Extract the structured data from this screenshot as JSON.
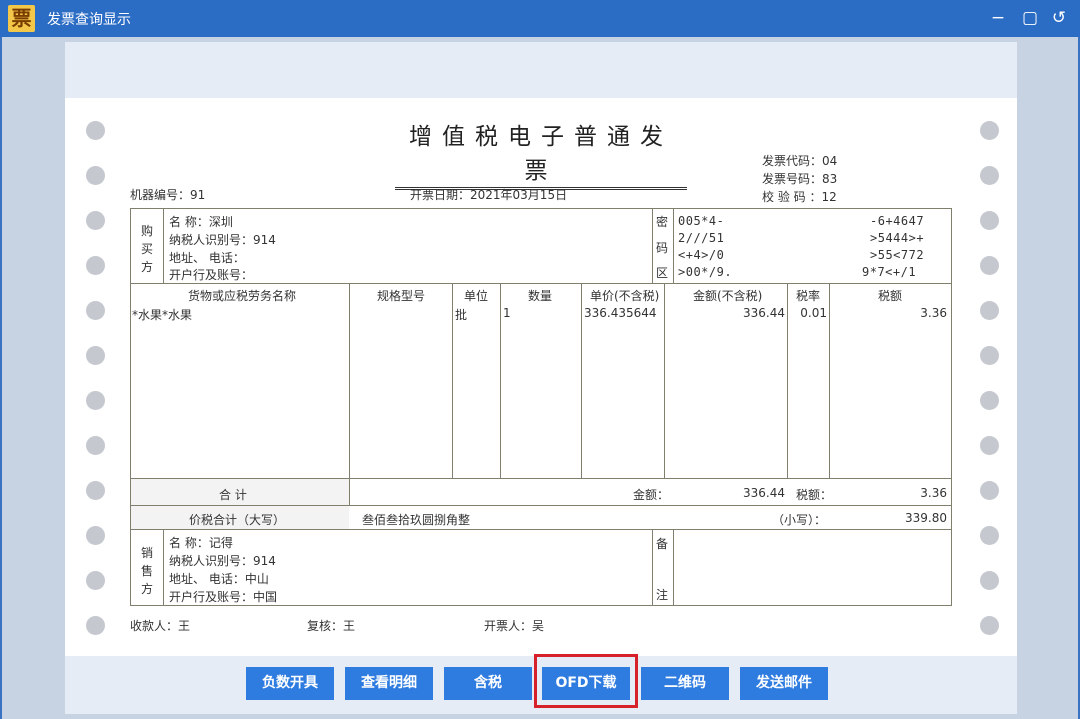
{
  "window": {
    "app_icon": "票",
    "title": "发票查询显示",
    "minimize": "−",
    "restore": "▢",
    "back": "↺"
  },
  "invoice": {
    "title": "增值税电子普通发票",
    "machine_no": "机器编号：91",
    "issue_date": "开票日期：2021年03月15日",
    "code": "发票代码：04",
    "number": "发票号码：83",
    "check": "校 验 码 ：12",
    "buyer": {
      "side_label": [
        "购",
        "买",
        "方"
      ],
      "name": "名        称：深圳",
      "tax_id": "纳税人识别号：914",
      "addr": "地址、    电话：",
      "bank": "开户行及账号："
    },
    "cipher": {
      "side_label": [
        "密",
        "码",
        "区"
      ],
      "lines": [
        [
          "005*4-",
          "-6+4647"
        ],
        [
          "2///51",
          ">5444>+"
        ],
        [
          "<+4>/0",
          ">55<772"
        ],
        [
          ">00*/9.",
          "9*7<+/1"
        ]
      ]
    },
    "headers": [
      "货物或应税劳务名称",
      "规格型号",
      "单位",
      "数量",
      "单价(不含税)",
      "金额(不含税)",
      "税率",
      "税额"
    ],
    "items": [
      {
        "name": "*水果*水果",
        "spec": "",
        "unit": "批",
        "qty": "1",
        "price": "336.435644",
        "amount": "336.44",
        "rate": "0.01",
        "tax": "3.36"
      }
    ],
    "total": {
      "label": "合    计",
      "amount_label": "金额：",
      "amount": "336.44",
      "tax_label": "税额：",
      "tax": "3.36"
    },
    "grand": {
      "label": "价税合计（大写）",
      "words": "叁佰叁拾玖圆捌角整",
      "small_label": "（小写）：",
      "small": "339.80"
    },
    "seller": {
      "side_label": [
        "销",
        "售",
        "方"
      ],
      "name": "名        称：记得",
      "tax_id": "纳税人识别号：914",
      "addr": "地址、    电话：中山",
      "bank": "开户行及账号：中国"
    },
    "remark_label": [
      "备",
      "注"
    ],
    "payee": "收款人：王",
    "reviewer": "复核：王",
    "drawer": "开票人：吴"
  },
  "buttons": {
    "negative": "负数开具",
    "details": "查看明细",
    "tax": "含税",
    "ofd": "OFD下载",
    "qrcode": "二维码",
    "email": "发送邮件"
  },
  "colors": {
    "titlebar": "#2b6cc4",
    "button": "#2e7ce0",
    "highlight": "#d6212b"
  }
}
